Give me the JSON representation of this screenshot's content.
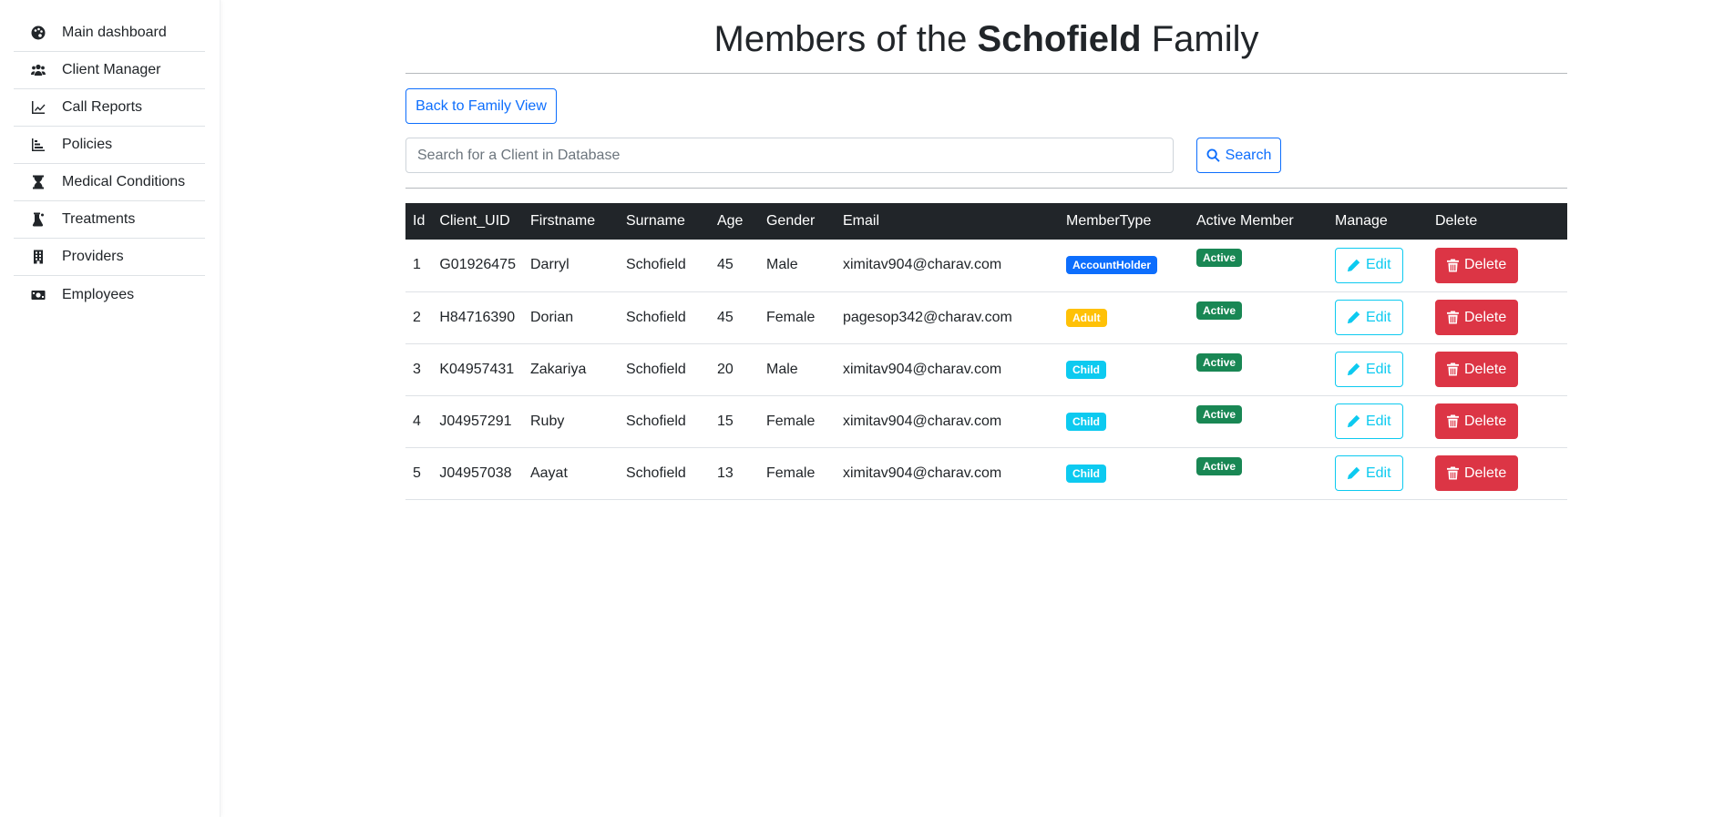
{
  "sidebar": {
    "items": [
      {
        "label": "Main dashboard",
        "icon": "palette-icon"
      },
      {
        "label": "Client Manager",
        "icon": "users-icon"
      },
      {
        "label": "Call Reports",
        "icon": "line-chart-icon"
      },
      {
        "label": "Policies",
        "icon": "bar-chart-icon"
      },
      {
        "label": "Medical Conditions",
        "icon": "hourglass-icon"
      },
      {
        "label": "Treatments",
        "icon": "flask-icon"
      },
      {
        "label": "Providers",
        "icon": "building-icon"
      },
      {
        "label": "Employees",
        "icon": "money-bill-icon"
      }
    ]
  },
  "header": {
    "title_prefix": "Members of the",
    "family_name": "Schofield",
    "title_suffix": "Family"
  },
  "back_button": "Back to Family View",
  "search": {
    "placeholder": "Search for a Client in Database",
    "value": "",
    "button_label": "Search"
  },
  "table": {
    "columns": [
      "Id",
      "Client_UID",
      "Firstname",
      "Surname",
      "Age",
      "Gender",
      "Email",
      "MemberType",
      "Active Member",
      "Manage",
      "Delete"
    ],
    "rows": [
      {
        "id": "1",
        "uid": "G01926475",
        "firstname": "Darryl",
        "surname": "Schofield",
        "age": "45",
        "gender": "Male",
        "email": "ximitav904@charav.com",
        "member_type": "AccountHolder",
        "active": "Active"
      },
      {
        "id": "2",
        "uid": "H84716390",
        "firstname": "Dorian",
        "surname": "Schofield",
        "age": "45",
        "gender": "Female",
        "email": "pagesop342@charav.com",
        "member_type": "Adult",
        "active": "Active"
      },
      {
        "id": "3",
        "uid": "K04957431",
        "firstname": "Zakariya",
        "surname": "Schofield",
        "age": "20",
        "gender": "Male",
        "email": "ximitav904@charav.com",
        "member_type": "Child",
        "active": "Active"
      },
      {
        "id": "4",
        "uid": "J04957291",
        "firstname": "Ruby",
        "surname": "Schofield",
        "age": "15",
        "gender": "Female",
        "email": "ximitav904@charav.com",
        "member_type": "Child",
        "active": "Active"
      },
      {
        "id": "5",
        "uid": "J04957038",
        "firstname": "Aayat",
        "surname": "Schofield",
        "age": "13",
        "gender": "Female",
        "email": "ximitav904@charav.com",
        "member_type": "Child",
        "active": "Active"
      }
    ],
    "edit_label": "Edit",
    "delete_label": "Delete"
  },
  "colors": {
    "primary": "#0d6efd",
    "info": "#0dcaf0",
    "warning": "#ffc107",
    "success": "#198754",
    "danger": "#dc3545",
    "dark": "#212529"
  }
}
